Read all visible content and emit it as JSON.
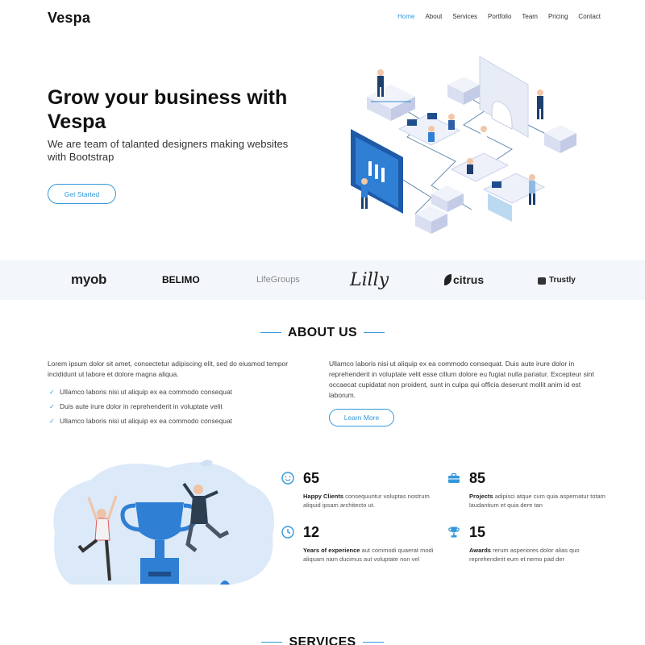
{
  "brand": {
    "name": "Vespa",
    "accent": "#3498db"
  },
  "nav": {
    "items": [
      {
        "label": "Home",
        "active": true
      },
      {
        "label": "About"
      },
      {
        "label": "Services"
      },
      {
        "label": "Portfolio"
      },
      {
        "label": "Team"
      },
      {
        "label": "Pricing"
      },
      {
        "label": "Contact"
      }
    ]
  },
  "hero": {
    "title": "Grow your business with Vespa",
    "subtitle": "We are team of talanted designers making websites with Bootstrap",
    "cta_label": "Get Started"
  },
  "clients": [
    "myob",
    "BELIMO",
    "LifeGroups",
    "Lilly",
    "citrus",
    "Trustly"
  ],
  "about": {
    "title": "ABOUT US",
    "left_text": "Lorem ipsum dolor sit amet, consectetur adipiscing elit, sed do eiusmod tempor incididunt ut labore et dolore magna aliqua.",
    "list": [
      "Ullamco laboris nisi ut aliquip ex ea commodo consequat",
      "Duis aute irure dolor in reprehenderit in voluptate velit",
      "Ullamco laboris nisi ut aliquip ex ea commodo consequat"
    ],
    "right_text": "Ullamco laboris nisi ut aliquip ex ea commodo consequat. Duis aute irure dolor in reprehenderit in voluptate velit esse cillum dolore eu fugiat nulla pariatur. Excepteur sint occaecat cupidatat non proident, sunt in culpa qui officia deserunt mollit anim id est laborum.",
    "learn_more_label": "Learn More"
  },
  "counts": [
    {
      "icon": "smile-icon",
      "number": "65",
      "label": "Happy Clients",
      "text": "consequuntur voluptas nostrum aliquid ipsam architecto ut."
    },
    {
      "icon": "briefcase-icon",
      "number": "85",
      "label": "Projects",
      "text": "adipisci atque cum quia aspernatur totam laudantium et quia dere tan"
    },
    {
      "icon": "clock-icon",
      "number": "12",
      "label": "Years of experience",
      "text": "aut commodi quaerat modi aliquam nam ducimus aut voluptate non vel"
    },
    {
      "icon": "trophy-icon",
      "number": "15",
      "label": "Awards",
      "text": "rerum asperiores dolor alias quo reprehenderit eum et nemo pad der"
    }
  ],
  "services": {
    "title": "SERVICES"
  }
}
